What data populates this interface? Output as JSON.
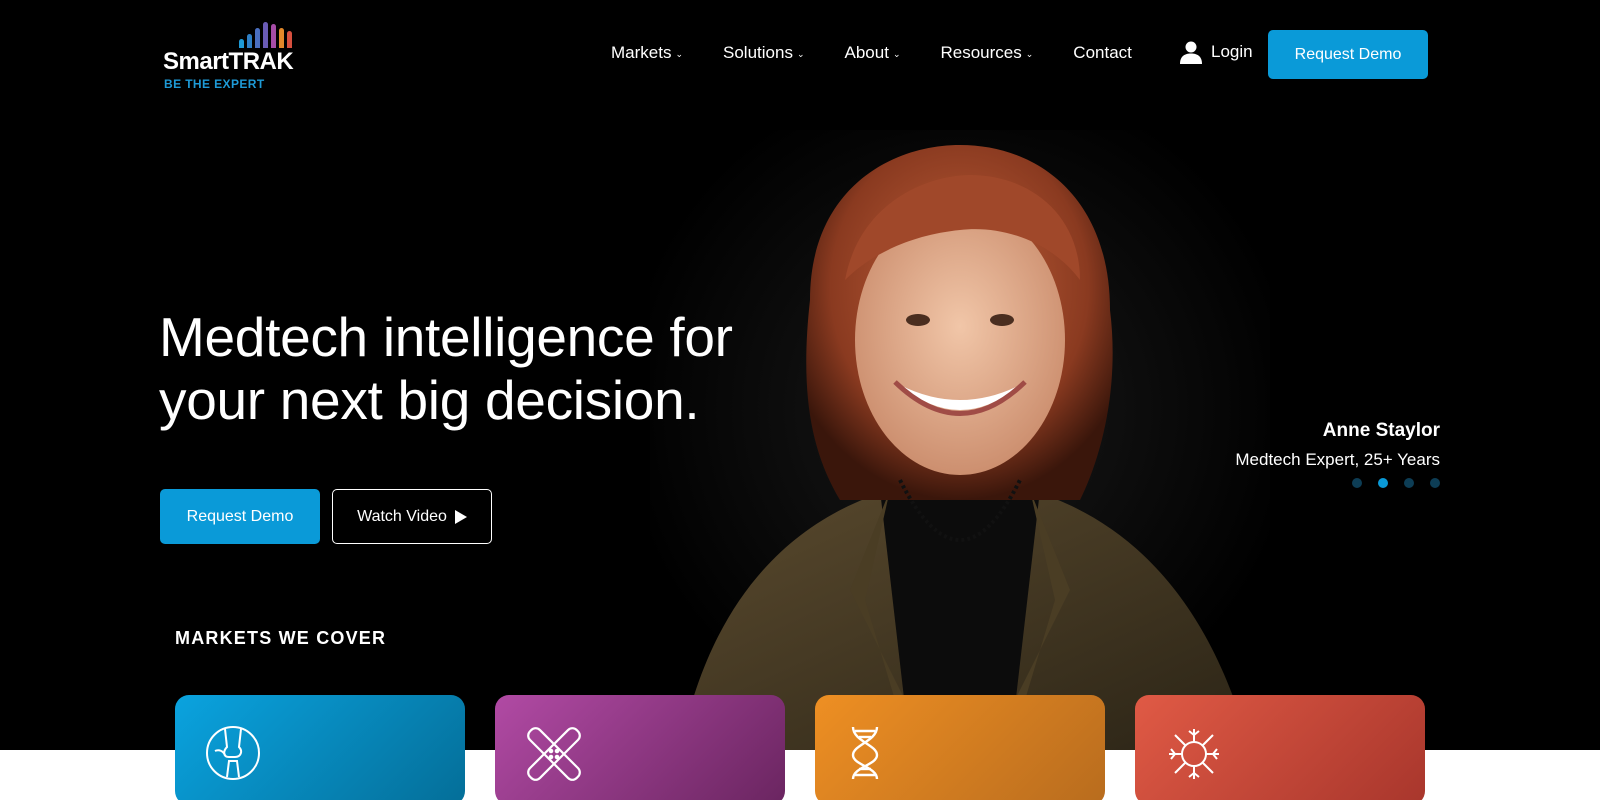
{
  "brand": {
    "name": "SmartTRAK",
    "tagline": "BE THE EXPERT",
    "accent": "#0a9ad8",
    "bar_colors": [
      "#1e9ad6",
      "#2e7fc5",
      "#6a5bb5",
      "#a64ca6",
      "#e2882a",
      "#d64f3e"
    ]
  },
  "nav": {
    "items": [
      {
        "label": "Markets",
        "has_dropdown": true
      },
      {
        "label": "Solutions",
        "has_dropdown": true
      },
      {
        "label": "About",
        "has_dropdown": true
      },
      {
        "label": "Resources",
        "has_dropdown": true
      },
      {
        "label": "Contact",
        "has_dropdown": false
      }
    ],
    "login_label": "Login",
    "login_icon": "user-icon",
    "cta_label": "Request Demo"
  },
  "hero": {
    "headline_line1": "Medtech intelligence for",
    "headline_line2": "your next big decision.",
    "primary_button": "Request Demo",
    "secondary_button": "Watch Video",
    "secondary_icon": "play-icon",
    "expert_name": "Anne Staylor",
    "expert_role": "Medtech Expert, 25+ Years",
    "carousel_count": 4,
    "carousel_active_index": 1
  },
  "markets": {
    "title": "MARKETS WE COVER",
    "cards": [
      {
        "icon": "knee-joint-icon",
        "colors": [
          "#0aa3df",
          "#046e98"
        ]
      },
      {
        "icon": "bandage-icon",
        "colors": [
          "#b14aa4",
          "#6a2560"
        ]
      },
      {
        "icon": "dna-icon",
        "colors": [
          "#ee8f23",
          "#b86c1e"
        ]
      },
      {
        "icon": "virus-icon",
        "colors": [
          "#e05a45",
          "#a8362c"
        ]
      }
    ]
  }
}
